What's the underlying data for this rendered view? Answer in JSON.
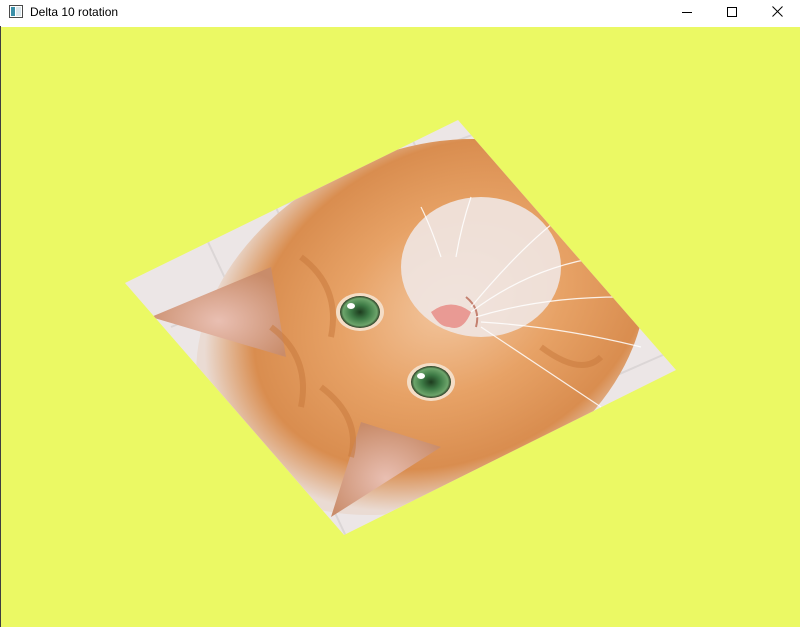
{
  "window": {
    "title": "Delta 10 rotation",
    "app_icon": "window-app-icon",
    "controls": {
      "minimize_icon": "minimize-icon",
      "maximize_icon": "maximize-icon",
      "close_icon": "close-icon"
    }
  },
  "canvas": {
    "background_color": "#ebf964",
    "image": {
      "subject": "kitten-photo",
      "rotation_step_degrees": 10
    }
  }
}
